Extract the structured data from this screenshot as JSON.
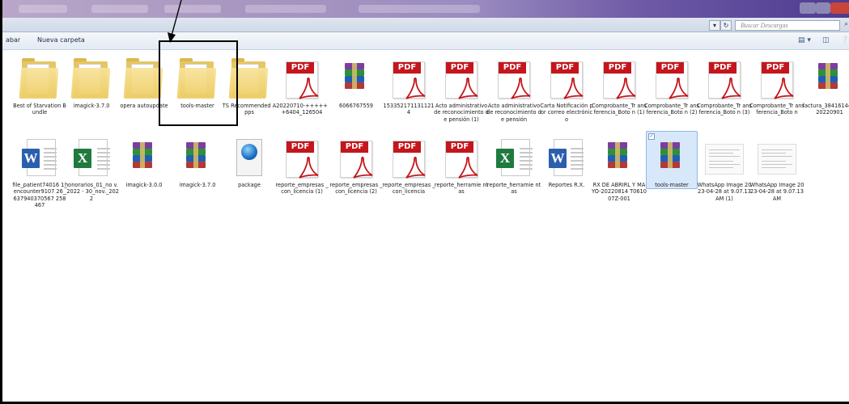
{
  "window": {
    "search_placeholder": "Buscar Descargas",
    "nav_dropdown": "▾",
    "nav_refresh": "↻"
  },
  "toolbar": {
    "items": [
      "abar",
      "Nueva carpeta"
    ],
    "view_icons": [
      "▤ ▾",
      "◫",
      "❔"
    ]
  },
  "files": [
    {
      "label": "Best of Starvation Bundle",
      "type": "folder"
    },
    {
      "label": "imagick-3.7.0",
      "type": "folder"
    },
    {
      "label": "opera autoupdate",
      "type": "folder"
    },
    {
      "label": "tools-master",
      "type": "folder"
    },
    {
      "label": "TS Recommended Apps",
      "type": "folder"
    },
    {
      "label": "20220710-+++++ +6404_126504",
      "type": "pdf"
    },
    {
      "label": "6066767559",
      "type": "rar"
    },
    {
      "label": "153352171131121 4",
      "type": "pdf"
    },
    {
      "label": "Acto administrativo de reconocimiento de pensión (1)",
      "type": "pdf"
    },
    {
      "label": "Acto administrativo de reconocimiento de pensión",
      "type": "pdf"
    },
    {
      "label": "Carta Notificación por correo electrónico",
      "type": "pdf"
    },
    {
      "label": "Comprobante_Tr ansferencia_Boto n (1)",
      "type": "pdf"
    },
    {
      "label": "Comprobante_Tr ansferencia_Boto n (2)",
      "type": "pdf"
    },
    {
      "label": "Comprobante_Tr ansferencia_Boto n (3)",
      "type": "pdf"
    },
    {
      "label": "Comprobante_Tr ansferencia_Boto n",
      "type": "pdf"
    },
    {
      "label": "factura_38416144 720220901",
      "type": "rar"
    },
    {
      "label": "file_patient74016 1_encounter9107 26_637940370567 258467",
      "type": "word"
    },
    {
      "label": "honorarios_01_no v._2022 - 30_nov._2022",
      "type": "excel"
    },
    {
      "label": "imagick-3.0.0",
      "type": "rar"
    },
    {
      "label": "imagick-3.7.0",
      "type": "rar"
    },
    {
      "label": "package",
      "type": "package"
    },
    {
      "label": "reporte_empresas _con_licencia (1)",
      "type": "pdf"
    },
    {
      "label": "reporte_empresas _con_licencia (2)",
      "type": "pdf"
    },
    {
      "label": "reporte_empresas _con_licencia",
      "type": "pdf"
    },
    {
      "label": "reporte_herramie ntas",
      "type": "pdf"
    },
    {
      "label": "reporte_herramie ntas",
      "type": "excel"
    },
    {
      "label": "Reportes R.X.",
      "type": "word"
    },
    {
      "label": "RX DE ABRIRL Y MAYO-20220814 T061007Z-001",
      "type": "rar"
    },
    {
      "label": "tools-master",
      "type": "rar",
      "selected": true
    },
    {
      "label": "WhatsApp Image 2023-04-28 at 9.07.13 AM (1)",
      "type": "image"
    },
    {
      "label": "WhatsApp Image 2023-04-28 at 9.07.13 AM",
      "type": "image"
    }
  ],
  "pdf_banner_text": "PDF",
  "colors": {
    "pdf_red": "#c4161c",
    "word_blue": "#2b5fae",
    "excel_green": "#1f7a3e",
    "selection": "#d7e8fb"
  }
}
